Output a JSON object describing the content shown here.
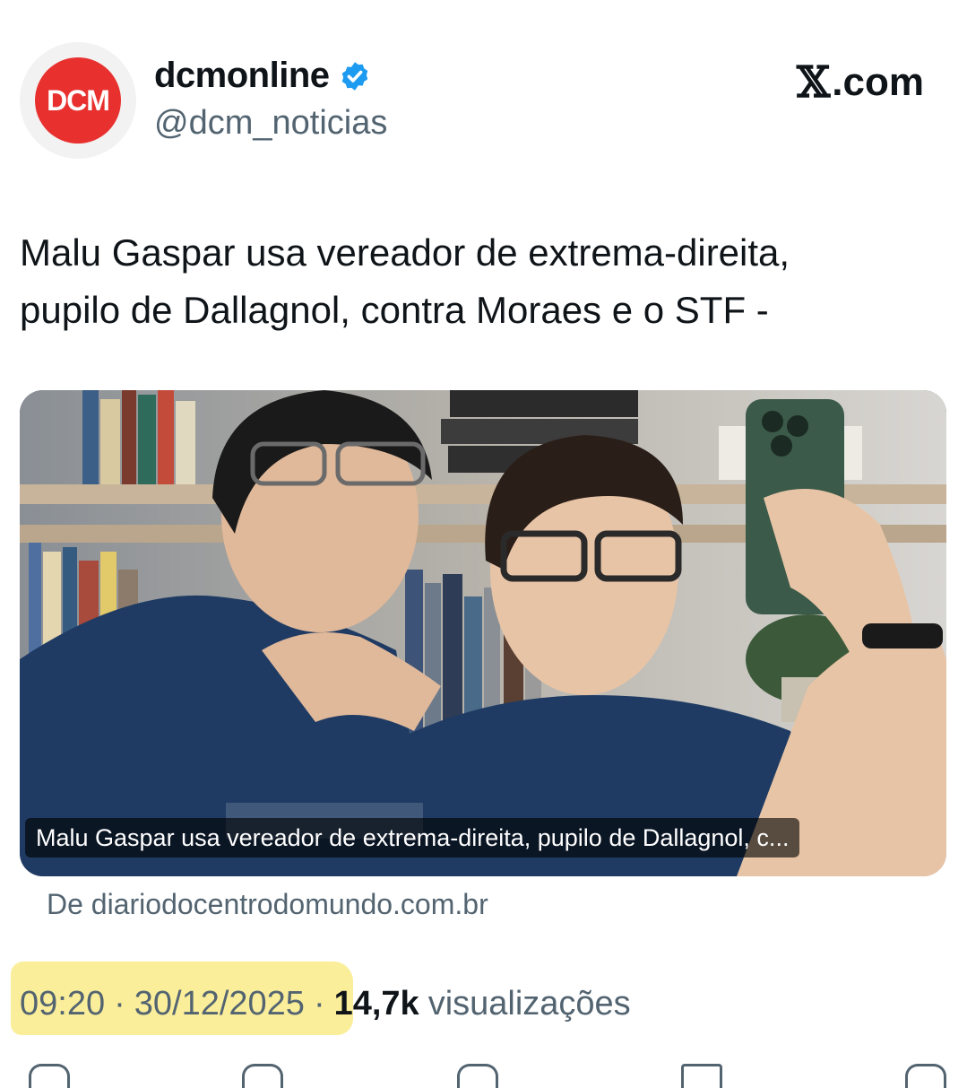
{
  "author": {
    "avatar_text": "DCM",
    "display_name": "dcmonline",
    "handle": "@dcm_noticias",
    "verified": true
  },
  "brand": {
    "logo": "𝕏",
    "suffix": ".com"
  },
  "tweet": {
    "text_line1": "Malu Gaspar usa vereador de extrema-direita,",
    "text_line2": "pupilo de Dallagnol, contra Moraes e o STF -"
  },
  "link_card": {
    "caption": "Malu Gaspar usa vereador de extrema-direita, pupilo de Dallagnol, c...",
    "source": "De diariodocentrodomundo.com.br"
  },
  "meta": {
    "time": "09:20",
    "separator": "·",
    "date": "30/12/2025",
    "views_count": "14,7k",
    "views_label": "visualizações"
  },
  "colors": {
    "accent_red": "#e8312f",
    "verified_blue": "#1d9bf0",
    "muted": "#536471",
    "highlight": "#fbec8f"
  },
  "icons": [
    "verified-badge-icon",
    "x-logo-icon",
    "reply-icon",
    "repost-icon",
    "like-icon",
    "bookmark-icon",
    "share-icon"
  ]
}
